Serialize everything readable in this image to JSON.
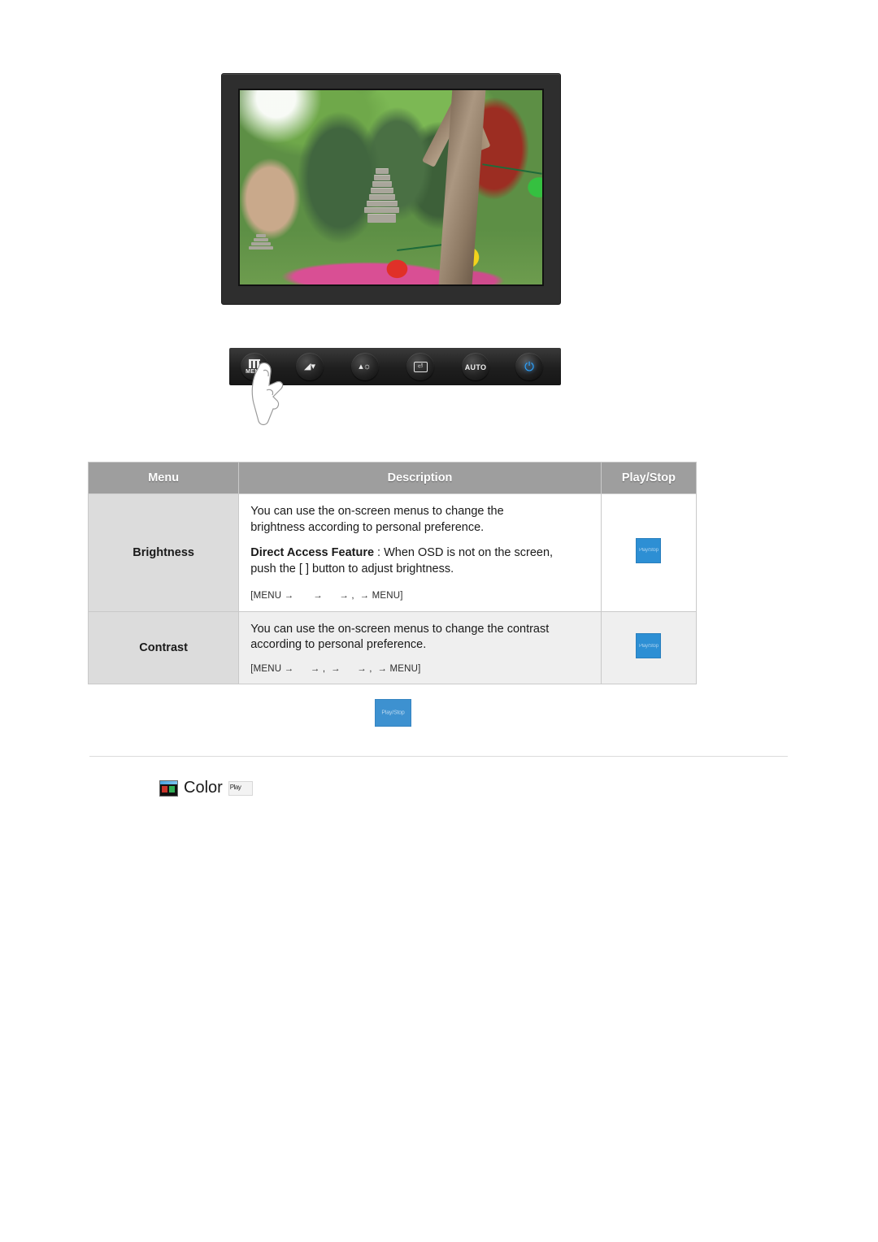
{
  "monitor": {
    "screen_photo_alt": "korean-garden-with-stone-pagoda-and-lanterns"
  },
  "control_panel": {
    "buttons": [
      {
        "name": "menu-button",
        "label": "MENU",
        "icon": "menu-bars-icon"
      },
      {
        "name": "down-button",
        "label": "",
        "icon": "down-arrow-wave-icon"
      },
      {
        "name": "up-brightness-button",
        "label": "",
        "icon": "up-arrow-sun-icon"
      },
      {
        "name": "enter-button",
        "label": "",
        "icon": "enter-key-icon"
      },
      {
        "name": "auto-button",
        "label": "AUTO",
        "icon": "auto-text-icon"
      },
      {
        "name": "power-button",
        "label": "",
        "icon": "power-icon"
      }
    ]
  },
  "table": {
    "headers": {
      "menu": "Menu",
      "description": "Description",
      "play_stop": "Play/Stop"
    },
    "rows": [
      {
        "menu": "Brightness",
        "description_line1": "You can use the on-screen menus to change the",
        "description_line2": "brightness according to personal preference.",
        "direct_access_bold": "Direct Access Feature",
        "direct_access_rest": " : When OSD is not on the screen,",
        "direct_access_line2": "push the [      ] button to adjust brightness.",
        "menu_path": "[MENU →       →      → ,  → MENU]",
        "play_stop_label": "Play/Stop"
      },
      {
        "menu": "Contrast",
        "description_line1": "You can use the on-screen menus to change the contrast",
        "description_line2": "according to personal preference.",
        "direct_access_bold": "",
        "direct_access_rest": "",
        "direct_access_line2": "",
        "menu_path": "[MENU →      → ,  →      → ,  → MENU]",
        "play_stop_label": "Play/Stop"
      }
    ]
  },
  "standalone_chip": {
    "label": "Play/Stop"
  },
  "color_section": {
    "title": "Color",
    "icon": "color-swatch-icon",
    "badge_label": "Play"
  },
  "colors": {
    "header_gray": "#9e9e9e",
    "menu_cell_gray": "#dcdcdc",
    "row_alt_gray": "#efefef",
    "chip_blue": "#2d8fd4",
    "power_blue": "#2ea3ff",
    "panel_dark": "#1e1e1e"
  }
}
